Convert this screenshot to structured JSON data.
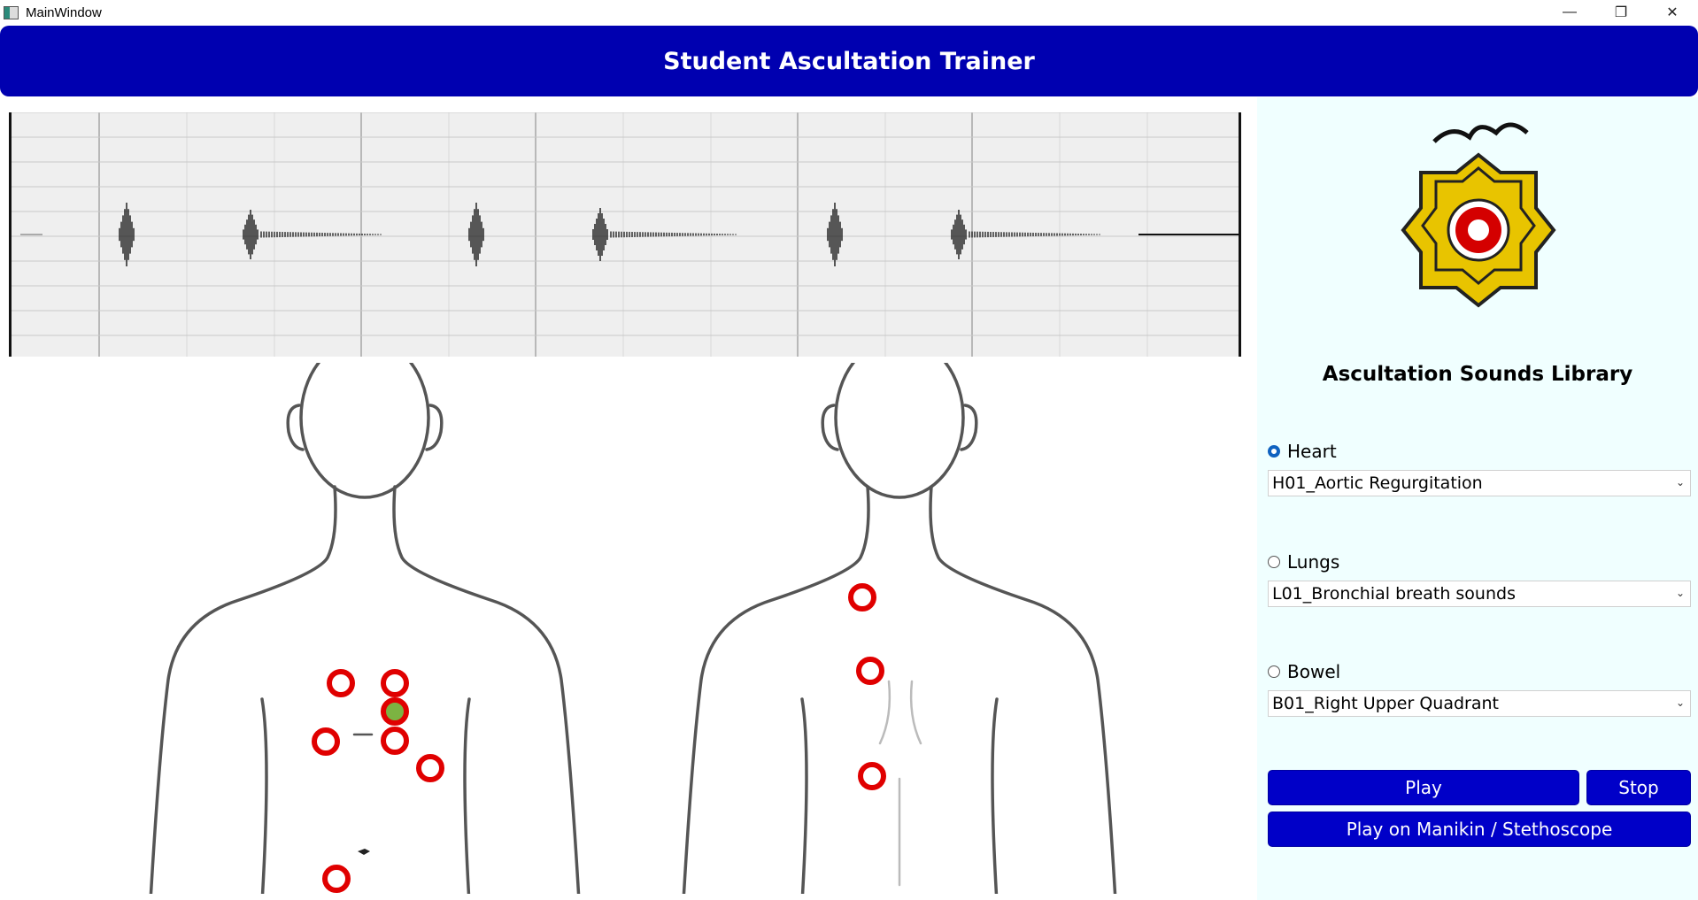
{
  "window": {
    "title": "MainWindow",
    "minimize_glyph": "—",
    "maximize_glyph": "❐",
    "close_glyph": "✕"
  },
  "header": {
    "title": "Student Ascultation Trainer"
  },
  "library": {
    "title": "Ascultation Sounds Library",
    "options": [
      {
        "label": "Heart",
        "checked": true,
        "selected": "H01_Aortic Regurgitation"
      },
      {
        "label": "Lungs",
        "checked": false,
        "selected": "L01_Bronchial breath sounds"
      },
      {
        "label": "Bowel",
        "checked": false,
        "selected": "B01_Right Upper Quadrant"
      }
    ]
  },
  "buttons": {
    "play": "Play",
    "stop": "Stop",
    "play_manikin": "Play on Manikin / Stethoscope"
  },
  "colors": {
    "header_bg": "#0000b0",
    "button_bg": "#0000c8",
    "panel_bg": "#f0ffff",
    "marker": "#e00000",
    "active_marker": "#7cb342"
  },
  "icons": {
    "window_icon": "app-window-icon",
    "logo": "college-crest-logo",
    "dropdown": "chevron-down-icon"
  }
}
